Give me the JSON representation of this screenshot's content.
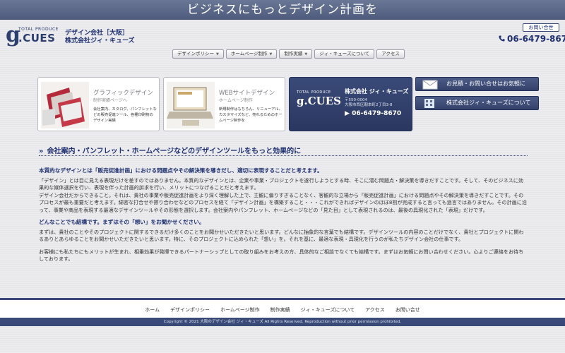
{
  "banner_text": "ビジネスにもっとデザイン計画を",
  "logo": {
    "top": "TOTAL PRODUCE",
    "letter": "g",
    "name": ".CUES"
  },
  "company": {
    "line1": "デザイン会社［大阪］",
    "line2": "株式会社ジィ・キューズ"
  },
  "header": {
    "inquiry_label": "お問い合世",
    "phone": "06-6479-8670"
  },
  "nav": [
    {
      "label": "デザインポリシー",
      "arrow": "▼"
    },
    {
      "label": "ホームページ制作",
      "arrow": "▼"
    },
    {
      "label": "制作実績",
      "arrow": "▼"
    },
    {
      "label": "ジィ・キューズについて",
      "arrow": ""
    },
    {
      "label": "アクセス",
      "arrow": ""
    }
  ],
  "banners": [
    {
      "title": "グラフィックデザイン",
      "sub": "制作実績ページへ",
      "desc": "会社案内、カタログ、パンフレットなどの販売促進ツール、各種印刷物のデザイン実績"
    },
    {
      "title": "WEBサイトデザイン",
      "sub": "ホームページ制作",
      "desc": "新規制作はもちろん、リニューアル、カスタマイズなど、売れるためのホームページ制作を"
    }
  ],
  "card": {
    "logo_top": "TOTAL PRODUCE",
    "logo_name": "g.CUES",
    "name": "株式会社 ジィ・キューズ",
    "zip": "〒550-0004",
    "addr": "大阪市西区靭本町2丁目3-8",
    "tel": "06-6479-8670"
  },
  "side_buttons": [
    "お見積・お問い合せはお気軽に",
    "株式会社ジィ・キューズについて"
  ],
  "section": {
    "title": "会社案内・パンフレット・ホームページなどのデザインツールをもっと効果的に",
    "marker": "»"
  },
  "content": {
    "head1": "本質的なデザインとは「販売促進計画」における問題点やその解決策を導きだし、適切に表現することだと考えます。",
    "p1": "「デザイン」とは目に見える表現だけを差すのではありません。本質的なデザインとは、企業や事業・プロジェクトを遂行しようとする時、そこに潜む問題点・解決策を導きだすことです。そして、そのビジネスに効果的な媒体選択を行い、表現を伴った計画的訴求を行い、メリットにつなげることだと考えます。",
    "p1b": "デザイン会社だからできること。それは、貴社の事業や販売促進計画をより深く理解した上で、主観に偏りすぎることなく、客観的な立場から「販売促進計画」における問題点やその解決策を導きだすことです。そのプロセスが最も重要だと考えます。綿密な打合せや擦り合わせなどのプロセスを経て「デザイン計画」を構築すること・・・これができればデザインのほぼ8割が完成すると言っても過言ではありません。その計画に沿って、事業や商品を表現する最適なデザインツールやその形態を選択します。会社案内やパンフレット、ホームページなどの「見た目」として表現されるのは、最後の具現化された「表現」だけです。",
    "head2": "どんなことでも結構です。まずはその「想い」をお聞かせください。",
    "p2": "まずは、貴社のことやそのプロジェクトに関するできるだけ多くのことをお聞かせいただきたいと思います。どんなに抽象的な言葉でも結構です。デザインツールの内容のことだけでなく、貴社とプロジェクトに関わるありとあらゆることをお聞かせいただきたいと思います。特に、そのプロジェクトに込められた「想い」を。それを基に、最適な表現・具現化を行うのが私たちデザイン会社の仕事です。",
    "p3": "お客様にも私たちにもメリットが生まれ、相乗効果が発揮できるパートナーシップとしての取り組みをお考えの方、具体的なご相談でなくても結構です。まずはお気軽にお問い合わせください。心よりご連絡をお待ちしております。"
  },
  "footer_nav": [
    "ホーム",
    "デザインポリシー",
    "ホームページ制作",
    "制作実績",
    "ジィ・キューズについて",
    "アクセス",
    "お問い合せ"
  ],
  "copyright": "Copyright © 2021 大阪のデザイン会社 ジィ・キューズ All Rights Reserved. Reproduction without prior permission prohibited.",
  "colors": {
    "navy": "#1f3170",
    "bar": "#3a4a78",
    "background": "#ebebee"
  }
}
